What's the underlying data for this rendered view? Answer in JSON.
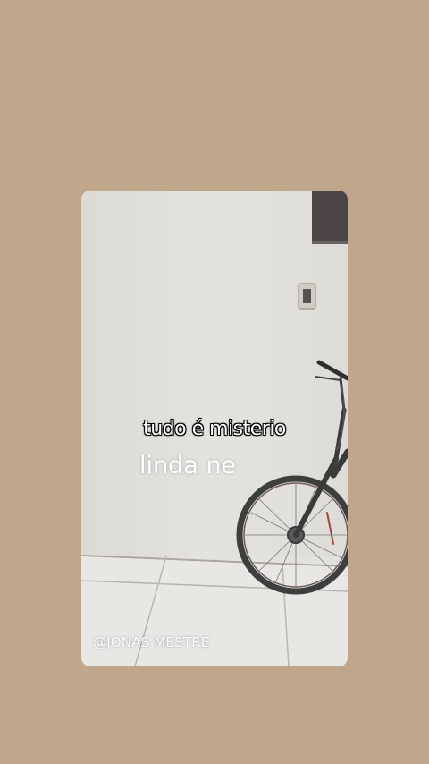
{
  "background_color": "#c0a68b",
  "story": {
    "caption_line1": "tudo é misterio",
    "caption_line2": "linda ne",
    "watermark": "@JONAS MESTRE",
    "photo": {
      "subject": "bicycle",
      "wall_color": "#e1dfda",
      "floor_color": "#e8e7e4"
    }
  }
}
